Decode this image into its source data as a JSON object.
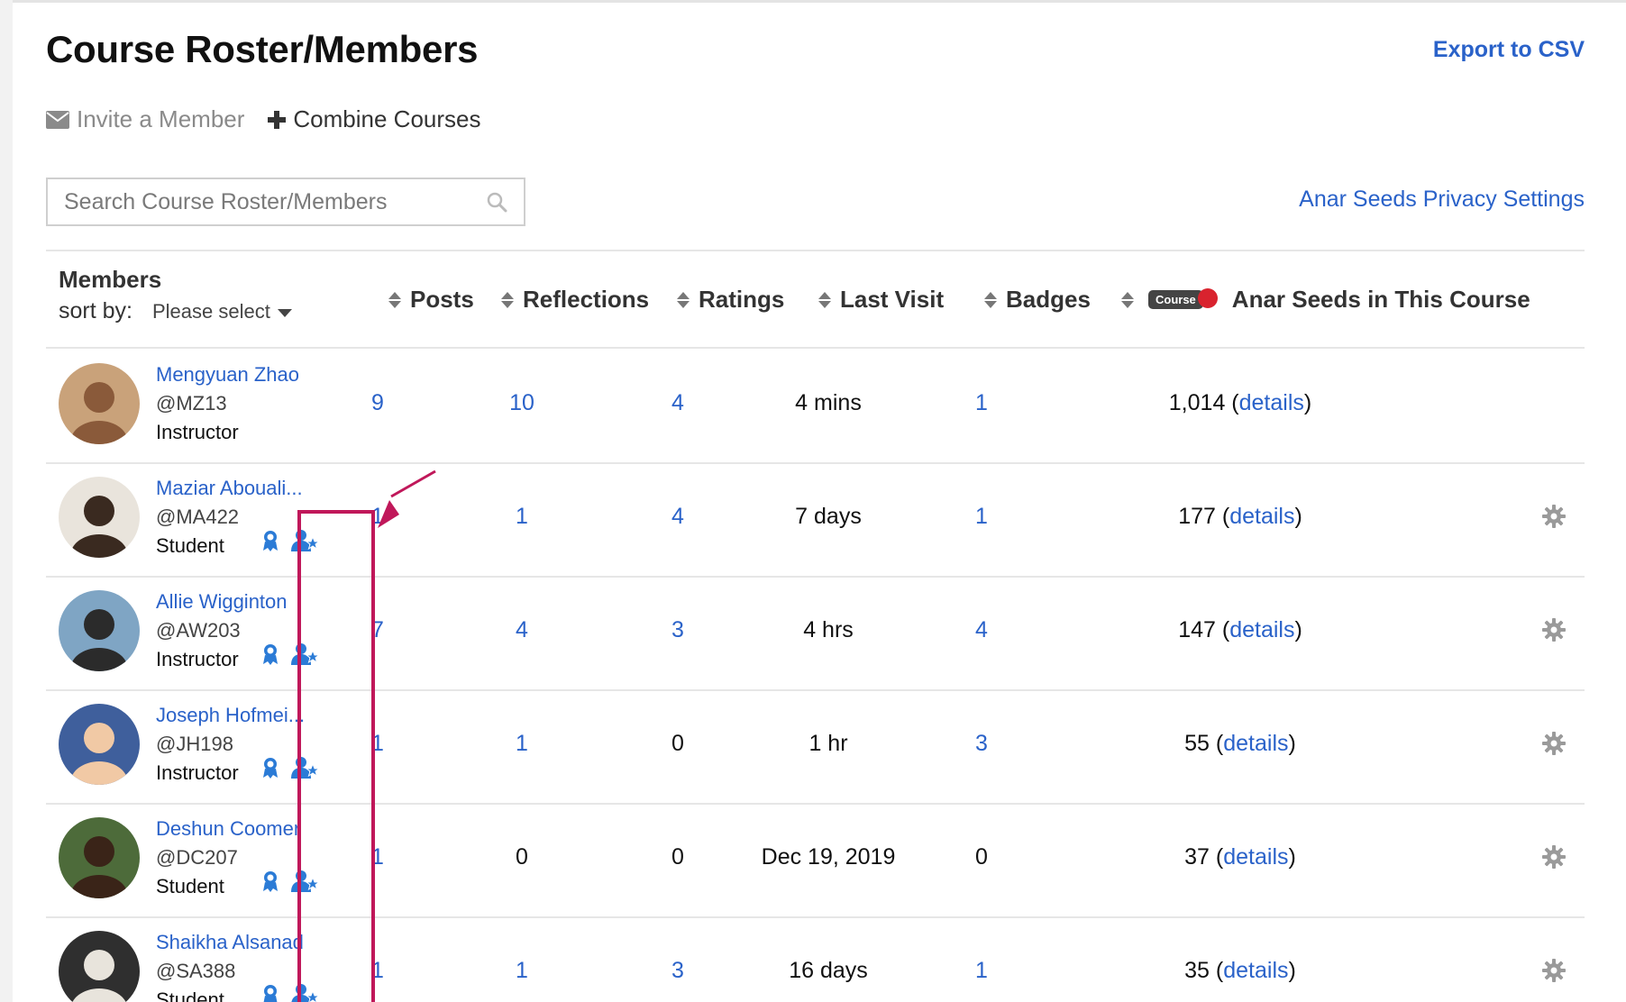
{
  "header": {
    "title": "Course Roster/Members",
    "export_label": "Export to CSV"
  },
  "actions": {
    "invite_label": "Invite a Member",
    "combine_label": "Combine Courses"
  },
  "search": {
    "placeholder": "Search Course Roster/Members"
  },
  "privacy_label": "Anar Seeds Privacy Settings",
  "table": {
    "members_label": "Members",
    "sort_by_label": "sort by:",
    "sort_select_value": "Please select",
    "course_pill": "Course",
    "columns": {
      "posts": "Posts",
      "reflections": "Reflections",
      "ratings": "Ratings",
      "last_visit": "Last Visit",
      "badges": "Badges",
      "seeds": "Anar Seeds in This Course"
    },
    "details_label": "details",
    "rows": [
      {
        "name": "Mengyuan Zhao",
        "handle": "@MZ13",
        "role": "Instructor",
        "posts": "9",
        "reflections": "10",
        "ratings": "4",
        "last_visit": "4 mins",
        "badges": "1",
        "seeds": "1,014"
      },
      {
        "name": "Maziar Abouali...",
        "handle": "@MA422",
        "role": "Student",
        "posts": "1",
        "reflections": "1",
        "ratings": "4",
        "last_visit": "7 days",
        "badges": "1",
        "seeds": "177"
      },
      {
        "name": "Allie Wigginton",
        "handle": "@AW203",
        "role": "Instructor",
        "posts": "7",
        "reflections": "4",
        "ratings": "3",
        "last_visit": "4 hrs",
        "badges": "4",
        "seeds": "147"
      },
      {
        "name": "Joseph Hofmei...",
        "handle": "@JH198",
        "role": "Instructor",
        "posts": "1",
        "reflections": "1",
        "ratings": "0",
        "last_visit": "1 hr",
        "badges": "3",
        "seeds": "55"
      },
      {
        "name": "Deshun Coomer",
        "handle": "@DC207",
        "role": "Student",
        "posts": "1",
        "reflections": "0",
        "ratings": "0",
        "last_visit": "Dec 19, 2019",
        "badges": "0",
        "seeds": "37"
      },
      {
        "name": "Shaikha Alsanad",
        "handle": "@SA388",
        "role": "Student",
        "posts": "1",
        "reflections": "1",
        "ratings": "3",
        "last_visit": "16 days",
        "badges": "1",
        "seeds": "35"
      }
    ]
  },
  "colors": {
    "link": "#2a62c9",
    "annotation": "#c0185a",
    "icon_blue": "#2b7bd6"
  }
}
